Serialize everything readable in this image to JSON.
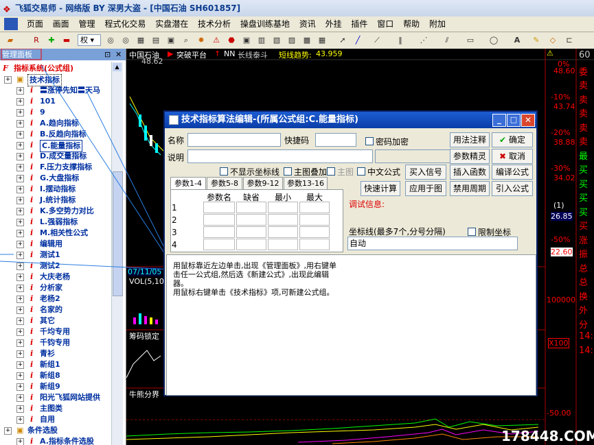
{
  "window": {
    "title": "飞狐交易师 - 网络版 BY 深男大盗 - [中国石油 SH601857]"
  },
  "menu": [
    "页面",
    "画面",
    "管理",
    "程式化交易",
    "实盘潜在",
    "技术分析",
    "操盘训练基地",
    "资讯",
    "外挂",
    "插件",
    "窗口",
    "帮助",
    "附加"
  ],
  "toolbar": {
    "dropdown_value": "权"
  },
  "panel": {
    "title": "管理面板",
    "root": "指标系统(公式组)",
    "group": "技术指标",
    "items": [
      "〓涨停先知〓天马",
      "101",
      "9",
      "A.趋向指标",
      "B.反趋向指标",
      "C.能量指标",
      "D.成交量指标",
      "F.压力支撑指标",
      "G.大盘指标",
      "I.摆动指标",
      "J.统计指标",
      "K.多空势力对比",
      "L.强弱指标",
      "M.相关性公式",
      "编辑用",
      "测试1",
      "测试2",
      "大庆老杨",
      "分析家",
      "老杨2",
      "名家的",
      "其它",
      "千均专用",
      "千钧专用",
      "青衫",
      "新组1",
      "新组8",
      "新组9",
      "阳光飞狐网站提供",
      "主图类",
      "自用"
    ],
    "group2": "条件选股",
    "item2": "A.指标条件选股"
  },
  "chart": {
    "stock": "中国石油",
    "platform": "突破平台",
    "nn": "NN",
    "line_label": "长线泰斗",
    "trend_label": "短线趋势:",
    "trend_value": "43.959",
    "price_top": "48.62",
    "right_scale": [
      "0%",
      "48.60",
      "-10%",
      "43.74",
      "-20%",
      "38.88",
      "-30%",
      "34.02",
      "26.85",
      "-50%",
      "22.60",
      "100000",
      "X100",
      "-50.00"
    ],
    "date": "07/11/05",
    "vol_label": "VOL(5,10",
    "chip_label": "筹码锁定",
    "energy_label": "牛熊分界",
    "far_right": [
      "60",
      "委",
      "卖",
      "卖",
      "卖",
      "卖",
      "卖",
      "最",
      "买",
      "买",
      "买",
      "买",
      "买",
      "涨",
      "振",
      "总",
      "总",
      "换",
      "外",
      "分",
      "14:",
      "14:"
    ],
    "watermark": "178448.COM",
    "bracket_1": "(1)"
  },
  "dialog": {
    "title": "技术指标算法编辑-(所属公式组:C.能量指标)",
    "name_label": "名称",
    "hotkey_label": "快捷码",
    "password_label": "密码加密",
    "desc_label": "说明",
    "no_axis_label": "不显示坐标线",
    "overlay_label": "主图叠加",
    "main_label": "主图",
    "chinese_label": "中文公式",
    "buttons": {
      "usage": "用法注释",
      "ok": "确定",
      "param": "参数精灵",
      "cancel": "取消",
      "buy": "买入信号",
      "insert_func": "插入函数",
      "compile": "编译公式",
      "quick_calc": "快速计算",
      "apply": "应用于图",
      "disable_period": "禁用周期",
      "import": "引入公式"
    },
    "tabs": [
      "参数1-4",
      "参数5-8",
      "参数9-12",
      "参数13-16"
    ],
    "grid_headers": [
      "参数名",
      "缺省",
      "最小",
      "最大"
    ],
    "grid_rows": [
      "1",
      "2",
      "3",
      "4"
    ],
    "debug_label": "调试信息:",
    "coord_label": "坐标线(最多7个,分号分隔)",
    "limit_label": "限制坐标",
    "coord_value": "自动",
    "tooltip_1": "用鼠标靠近左边单击,出现《管理面板》,用右键单击任一公式组,然后选《新建公式》,出现此编辑器。",
    "tooltip_2": "用鼠标右键单击《技术指标》项,可新建公式组。"
  },
  "colors": {
    "title_text": "#0b3c8e",
    "panel_text": "#0030a0",
    "red": "#dd0000",
    "chart_bg": "#000000",
    "dialog_title": "#0a3ea8"
  }
}
